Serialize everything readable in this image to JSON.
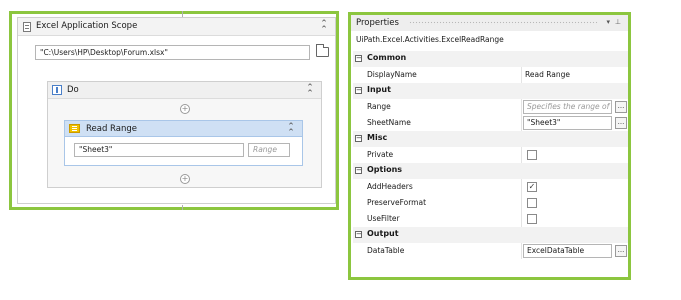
{
  "designer": {
    "scope_title": "Excel Application Scope",
    "file_path": "\"C:\\Users\\HP\\Desktop\\Forum.xlsx\"",
    "do_title": "Do",
    "read_range": {
      "title": "Read Range",
      "sheet_value": "\"Sheet3\"",
      "range_placeholder": "Range"
    }
  },
  "properties": {
    "title": "Properties",
    "activity_type": "UiPath.Excel.Activities.ExcelReadRange",
    "categories": [
      {
        "name": "Common",
        "props": [
          {
            "name": "DisplayName",
            "value": "Read Range"
          }
        ]
      },
      {
        "name": "Input",
        "props": [
          {
            "name": "Range",
            "placeholder": "Specifies the range of c"
          },
          {
            "name": "SheetName",
            "value": "\"Sheet3\""
          }
        ]
      },
      {
        "name": "Misc",
        "props": [
          {
            "name": "Private",
            "checked": false
          }
        ]
      },
      {
        "name": "Options",
        "props": [
          {
            "name": "AddHeaders",
            "checked": true
          },
          {
            "name": "PreserveFormat",
            "checked": false
          },
          {
            "name": "UseFilter",
            "checked": false
          }
        ]
      },
      {
        "name": "Output",
        "props": [
          {
            "name": "DataTable",
            "value": "ExcelDataTable"
          }
        ]
      }
    ]
  },
  "glyphs": {
    "collapse": "⌃",
    "plus": "+",
    "minus": "−",
    "ellipsis": "...",
    "check": "✓",
    "dropdown": "▾",
    "pin": "⊥",
    "close": "×"
  },
  "colors": {
    "highlight_border": "#8cc63f",
    "activity_header": "#cfe0f4",
    "excel_icon": "#f0c000"
  }
}
